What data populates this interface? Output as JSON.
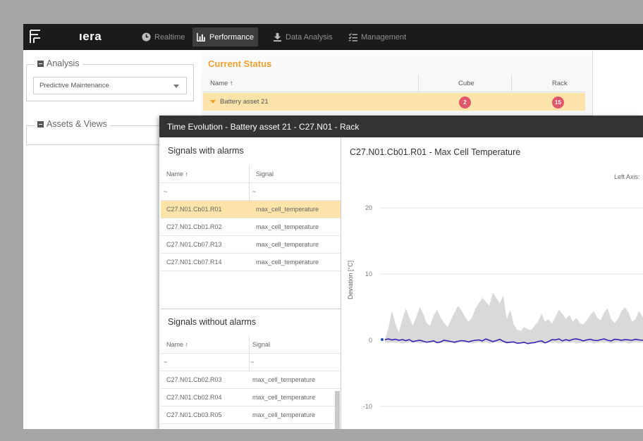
{
  "nav": {
    "brand": "ıera",
    "items": [
      {
        "label": "Realtime",
        "icon": "clock-icon"
      },
      {
        "label": "Performance",
        "icon": "bar-chart-icon",
        "active": true
      },
      {
        "label": "Data Analysis",
        "icon": "download-icon"
      },
      {
        "label": "Management",
        "icon": "list-check-icon"
      }
    ]
  },
  "left": {
    "analysis_legend": "Analysis",
    "analysis_select": "Predictive Maintenance",
    "assets_legend": "Assets & Views"
  },
  "current_status": {
    "title": "Current Status",
    "columns": [
      "Name ↑",
      "Cube",
      "Rack"
    ],
    "rows": [
      {
        "name": "Battery asset 21",
        "cube": "2",
        "rack": "15"
      }
    ]
  },
  "modal": {
    "title": "Time Evolution - Battery asset 21 - C27.N01 - Rack",
    "with_alarms": {
      "title": "Signals with alarms",
      "columns": [
        "Name ↑",
        "Signal"
      ],
      "filter": [
        "~",
        "~"
      ],
      "rows": [
        {
          "name": "C27.N01.Cb01.R01",
          "signal": "max_cell_temperature"
        },
        {
          "name": "C27.N01.Cb01.R02",
          "signal": "max_cell_temperature"
        },
        {
          "name": "C27.N01.Cb07.R13",
          "signal": "max_cell_temperature"
        },
        {
          "name": "C27.N01.Cb07.R14",
          "signal": "max_cell_temperature"
        }
      ]
    },
    "without_alarms": {
      "title": "Signals without alarms",
      "columns": [
        "Name ↑",
        "Signal"
      ],
      "filter": [
        "~",
        "~"
      ],
      "rows": [
        {
          "name": "C27.N01.Cb02.R03",
          "signal": "max_cell_temperature"
        },
        {
          "name": "C27.N01.Cb02.R04",
          "signal": "max_cell_temperature"
        },
        {
          "name": "C27.N01.Cb03.R05",
          "signal": "max_cell_temperature"
        }
      ]
    }
  },
  "chart_data": {
    "type": "line",
    "title": "C27.N01.Cb01.R01 - Max Cell Temperature",
    "axis_caption": "Left Axis:",
    "ylabel": "Deviation [°C]",
    "yticks": [
      20,
      10,
      0,
      -10
    ],
    "ylim": [
      -10,
      20
    ],
    "grid": true,
    "series": [
      {
        "kind": "band",
        "color": "#d9d9d9",
        "upper": [
          0.2,
          1.8,
          4.5,
          2.5,
          1.2,
          3.2,
          4.8,
          3.5,
          2.2,
          3.5,
          5.0,
          4.0,
          2.6,
          2.2,
          3.8,
          4.6,
          3.4,
          2.6,
          2.0,
          3.1,
          4.2,
          5.2,
          4.5,
          3.6,
          2.8,
          3.4,
          4.8,
          5.6,
          6.4,
          5.8,
          5.2,
          7.2,
          6.4,
          5.6,
          6.8,
          3.2,
          4.6,
          2.4,
          1.6,
          1.4,
          2.0,
          1.7,
          1.5,
          2.2,
          2.8,
          4.0,
          2.8,
          3.2,
          2.5,
          3.6,
          4.6,
          4.0,
          3.2,
          3.8,
          2.8,
          3.4,
          2.6,
          2.4,
          3.0,
          3.8,
          4.4,
          3.4,
          3.0,
          4.2,
          4.8,
          3.2,
          2.6,
          3.2,
          4.4,
          5.0,
          4.2,
          2.8,
          3.2,
          4.4,
          3.6,
          2.8,
          3.4,
          4.6
        ],
        "lower": [
          -0.3,
          -0.4,
          -0.3,
          -0.4,
          -0.3,
          -0.5,
          -0.4,
          -0.3,
          -0.4,
          -0.3,
          -0.5,
          -0.4,
          -0.3,
          -0.4,
          -0.3,
          -0.5,
          -0.4,
          -0.3,
          -0.4,
          -0.3,
          -0.5,
          -0.4,
          -0.3,
          -0.4,
          -0.3,
          -0.5,
          -0.4,
          -0.3,
          -0.4,
          -0.3,
          -0.5,
          -0.4,
          -0.3,
          -0.4,
          -0.3,
          -0.5,
          -0.4,
          -0.3,
          -0.4,
          -0.3,
          -0.5,
          -0.4,
          -0.3,
          -0.4,
          -0.3,
          -0.5,
          -0.4,
          -0.3,
          -0.4,
          -0.3,
          -0.5,
          -0.4,
          -0.3,
          -0.4,
          -0.3,
          -0.5,
          -0.4,
          -0.3,
          -0.4,
          -0.3,
          -0.5,
          -0.4,
          -0.3,
          -0.4,
          -0.3,
          -0.5,
          -0.4,
          -0.3,
          -0.4,
          -0.3,
          -0.5,
          -0.4,
          -0.3,
          -0.4,
          -0.3,
          -0.5,
          -0.4,
          -0.3
        ]
      },
      {
        "kind": "line",
        "color": "#3b1fb0",
        "values": [
          0.1,
          0.2,
          0.05,
          0.15,
          0.0,
          0.1,
          -0.05,
          0.1,
          -0.2,
          -0.1,
          0.0,
          -0.15,
          -0.3,
          -0.2,
          -0.1,
          -0.35,
          -0.25,
          0.0,
          -0.1,
          -0.2,
          -0.3,
          -0.15,
          -0.05,
          -0.1,
          -0.25,
          -0.1,
          0.0,
          0.05,
          -0.1,
          0.2,
          0.0,
          -0.2,
          -0.05,
          0.15,
          -0.15,
          -0.35,
          -0.3,
          -0.25,
          -0.45,
          -0.4,
          -0.3,
          -0.5,
          -0.4,
          -0.35,
          -0.2,
          -0.1,
          -0.4,
          -0.2,
          0.1,
          0.05,
          0.2,
          -0.1,
          0.1,
          -0.05,
          0.15,
          0.2,
          0.1,
          -0.1,
          0.05,
          0.15,
          0.0,
          -0.05,
          0.1,
          0.2,
          0.0,
          -0.1,
          0.15,
          0.1,
          0.0,
          0.1,
          0.05,
          0.0,
          0.15,
          0.05,
          0.0,
          0.1,
          0.05,
          0.0
        ],
        "marker_color": "#1e50b4"
      }
    ]
  }
}
